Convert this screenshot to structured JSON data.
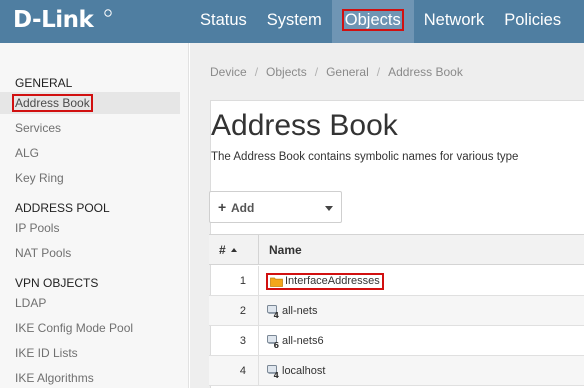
{
  "brand": {
    "logo_text": "D-Link"
  },
  "nav": [
    {
      "label": "Status",
      "active": false
    },
    {
      "label": "System",
      "active": false
    },
    {
      "label": "Objects",
      "active": true
    },
    {
      "label": "Network",
      "active": false
    },
    {
      "label": "Policies",
      "active": false
    }
  ],
  "sidebar": {
    "sections": [
      {
        "heading": "GENERAL",
        "items": [
          "Address Book",
          "Services",
          "ALG",
          "Key Ring"
        ]
      },
      {
        "heading": "ADDRESS POOL",
        "items": [
          "IP Pools",
          "NAT Pools"
        ]
      },
      {
        "heading": "VPN OBJECTS",
        "items": [
          "LDAP",
          "IKE Config Mode Pool",
          "IKE ID Lists",
          "IKE Algorithms"
        ]
      }
    ],
    "active_item": "Address Book"
  },
  "breadcrumb": [
    "Device",
    "Objects",
    "General",
    "Address Book"
  ],
  "page": {
    "title": "Address Book",
    "description": "The Address Book contains symbolic names for various type"
  },
  "toolbar": {
    "add_label": "Add"
  },
  "table": {
    "columns": {
      "num": "#",
      "name": "Name"
    },
    "rows": [
      {
        "num": "1",
        "name": "InterfaceAddresses",
        "icon": "folder-icon",
        "badge": ""
      },
      {
        "num": "2",
        "name": "all-nets",
        "icon": "ip-address-icon",
        "badge": "4"
      },
      {
        "num": "3",
        "name": "all-nets6",
        "icon": "ip-address-icon",
        "badge": "6"
      },
      {
        "num": "4",
        "name": "localhost",
        "icon": "ip-address-icon",
        "badge": "4"
      }
    ]
  },
  "colors": {
    "topbar": "#4f7ea1",
    "highlight": "#d11010",
    "folder": "#f3a61b"
  }
}
